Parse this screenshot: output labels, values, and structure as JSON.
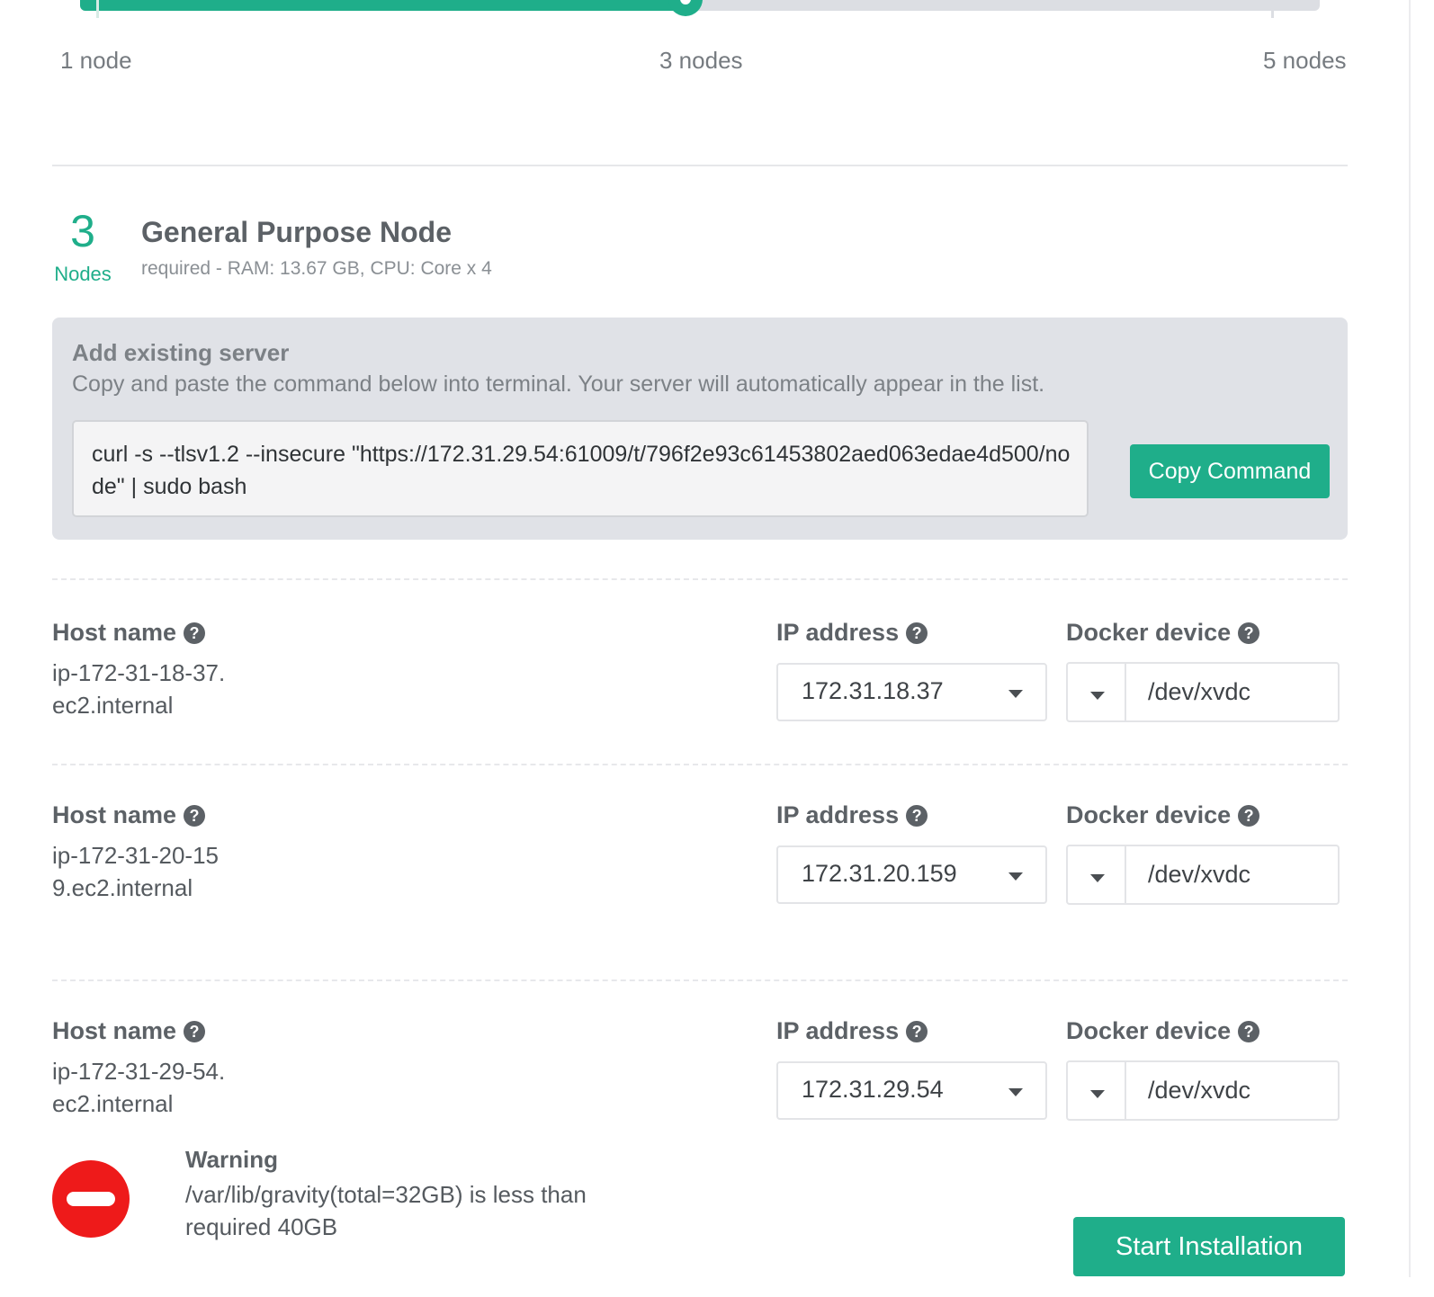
{
  "slider": {
    "min_label": "1 node",
    "mid_label": "3 nodes",
    "max_label": "5 nodes",
    "min": 1,
    "max": 5,
    "value": 3
  },
  "profile": {
    "count": "3",
    "count_label": "Nodes",
    "title": "General Purpose Node",
    "requirements": "required - RAM: 13.67 GB, CPU: Core x 4"
  },
  "add_server": {
    "title": "Add existing server",
    "description": "Copy and paste the command below into terminal. Your server will automatically appear in the list.",
    "command": "curl -s --tlsv1.2 --insecure \"https://172.31.29.54:61009/t/796f2e93c61453802aed063edae4d500/node\" | sudo bash",
    "copy_button": "Copy Command"
  },
  "labels": {
    "host_name": "Host name",
    "ip_address": "IP address",
    "docker_device": "Docker device"
  },
  "servers": [
    {
      "host": "ip-172-31-18-37.ec2.internal",
      "ip": "172.31.18.37",
      "docker_device": "/dev/xvdc"
    },
    {
      "host": "ip-172-31-20-159.ec2.internal",
      "ip": "172.31.20.159",
      "docker_device": "/dev/xvdc"
    },
    {
      "host": "ip-172-31-29-54.ec2.internal",
      "ip": "172.31.29.54",
      "docker_device": "/dev/xvdc"
    }
  ],
  "warning": {
    "title": "Warning",
    "text": "/var/lib/gravity(total=32GB) is less than required 40GB",
    "icon": "no-entry-icon"
  },
  "start_button": "Start Installation",
  "colors": {
    "accent": "#1fae8a",
    "warning": "#ee1a1a",
    "panel": "#e0e2e7"
  }
}
